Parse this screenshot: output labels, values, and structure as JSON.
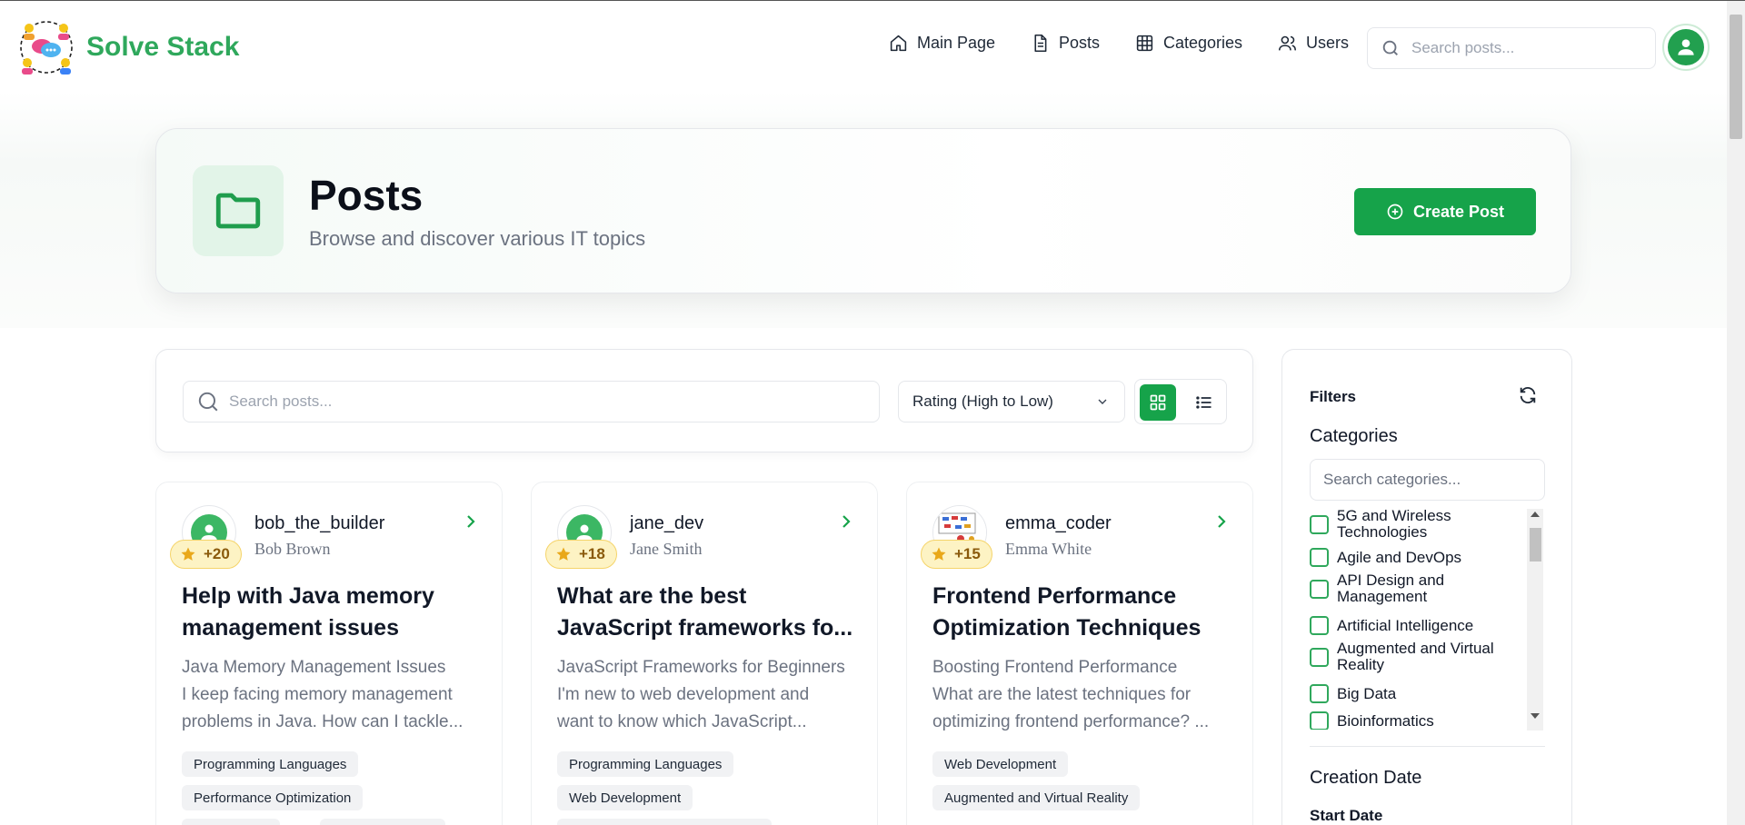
{
  "brand": {
    "name": "Solve Stack"
  },
  "nav": [
    {
      "label": "Main Page",
      "icon": "home-icon"
    },
    {
      "label": "Posts",
      "icon": "document-icon"
    },
    {
      "label": "Categories",
      "icon": "grid-icon"
    },
    {
      "label": "Users",
      "icon": "users-icon"
    }
  ],
  "header_search": {
    "placeholder": "Search posts..."
  },
  "hero": {
    "title": "Posts",
    "subtitle": "Browse and discover various IT topics",
    "create_label": "Create Post"
  },
  "toolbar": {
    "search_placeholder": "Search posts...",
    "sort_value": "Rating (High to Low)"
  },
  "posts": [
    {
      "username": "bob_the_builder",
      "fullname": "Bob Brown",
      "score": "+20",
      "title_lines": [
        "Help with Java memory",
        "management issues"
      ],
      "desc_lines": [
        "Java Memory Management Issues",
        "I keep facing memory management",
        "problems in Java. How can I tackle..."
      ],
      "tags": [
        "Programming Languages",
        "Performance Optimization"
      ]
    },
    {
      "username": "jane_dev",
      "fullname": "Jane Smith",
      "score": "+18",
      "title_lines": [
        "What are the best",
        "JavaScript frameworks fo..."
      ],
      "desc_lines": [
        "JavaScript Frameworks for Beginners",
        "I'm new to web development and",
        "want to know which JavaScript..."
      ],
      "tags": [
        "Programming Languages",
        "Web Development"
      ]
    },
    {
      "username": "emma_coder",
      "fullname": "Emma White",
      "score": "+15",
      "title_lines": [
        "Frontend Performance",
        "Optimization Techniques"
      ],
      "desc_lines": [
        "Boosting Frontend Performance",
        "What are the latest techniques for",
        "optimizing frontend performance? ..."
      ],
      "tags": [
        "Web Development",
        "Augmented and Virtual Reality"
      ]
    }
  ],
  "filters": {
    "title": "Filters",
    "categories_heading": "Categories",
    "categories_placeholder": "Search categories...",
    "categories": [
      "5G and Wireless Technologies",
      "Agile and DevOps",
      "API Design and Management",
      "Artificial Intelligence",
      "Augmented and Virtual Reality",
      "Big Data",
      "Bioinformatics"
    ],
    "date_heading": "Creation Date",
    "start_label": "Start Date"
  },
  "colors": {
    "brand_green": "#2fa85c",
    "button_green": "#16a34a",
    "score_bg": "#fdf3c4"
  }
}
